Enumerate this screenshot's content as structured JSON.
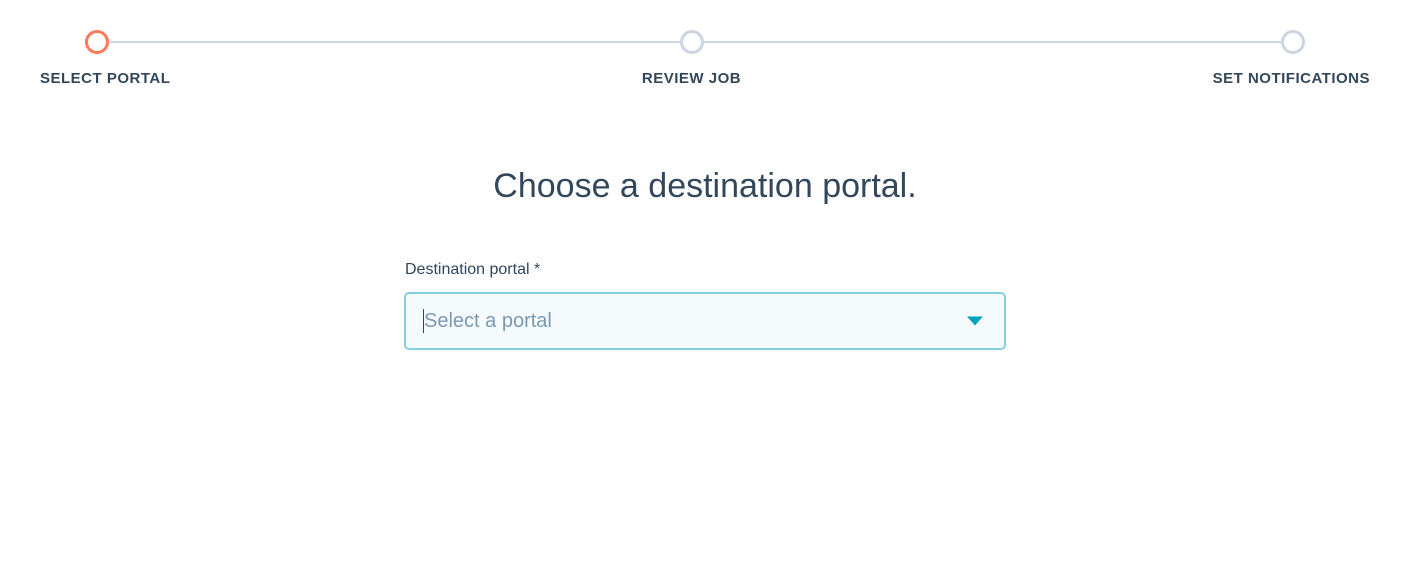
{
  "stepper": {
    "steps": [
      {
        "label": "SELECT PORTAL",
        "active": true
      },
      {
        "label": "REVIEW JOB",
        "active": false
      },
      {
        "label": "SET NOTIFICATIONS",
        "active": false
      }
    ]
  },
  "main": {
    "heading": "Choose a destination portal."
  },
  "form": {
    "destination_portal": {
      "label": "Destination portal *",
      "placeholder": "Select a portal",
      "value": ""
    }
  }
}
